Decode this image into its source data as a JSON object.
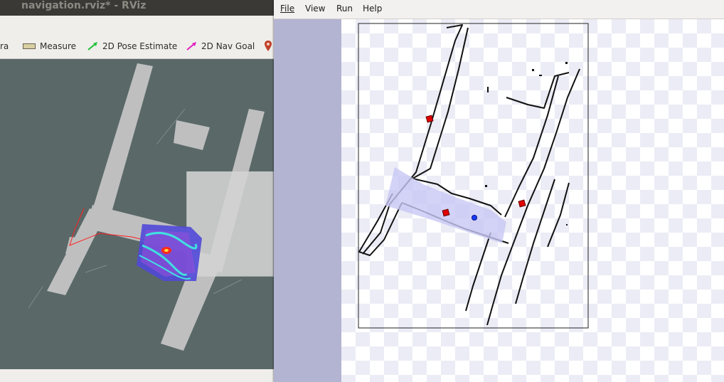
{
  "rviz": {
    "title": "navigation.rviz* - RViz",
    "toolbar": {
      "camera_label": "ra",
      "measure_label": "Measure",
      "pose_label": "2D Pose Estimate",
      "goal_label": "2D Nav Goal"
    },
    "colors": {
      "map_background": "#5a6868",
      "free_space": "#bfbfbf",
      "costmap": "#5050e0",
      "path": "#ff2020"
    }
  },
  "stage": {
    "menu": {
      "file": "File",
      "view": "View",
      "run": "Run",
      "help": "Help"
    },
    "colors": {
      "robot": "#1a3cff",
      "obstacle": "#e00000",
      "laser": "#c8c8f5"
    }
  }
}
